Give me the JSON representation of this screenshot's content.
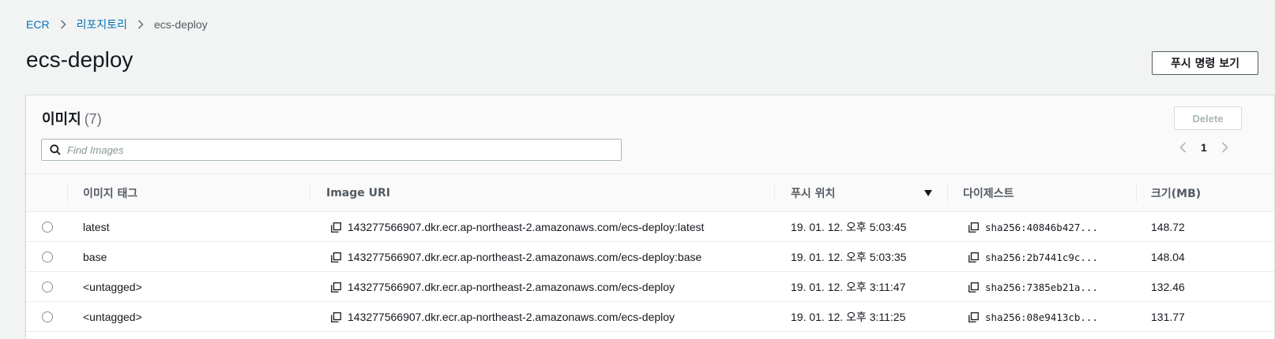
{
  "breadcrumb": {
    "items": [
      {
        "label": "ECR"
      },
      {
        "label": "리포지토리"
      }
    ],
    "current": "ecs-deploy"
  },
  "page": {
    "title": "ecs-deploy",
    "push_button": "푸시 명령 보기"
  },
  "images_panel": {
    "title": "이미지",
    "count": "(7)",
    "delete_label": "Delete",
    "search_placeholder": "Find Images",
    "current_page": "1"
  },
  "table": {
    "columns": {
      "tag": "이미지 태그",
      "uri": "Image URI",
      "pushed_at": "푸시 위치",
      "digest": "다이제스트",
      "size": "크기(MB)"
    },
    "rows": [
      {
        "tag": "latest",
        "uri": "143277566907.dkr.ecr.ap-northeast-2.amazonaws.com/ecs-deploy:latest",
        "pushed_at": "19. 01. 12. 오후 5:03:45",
        "digest": "sha256:40846b427...",
        "size": "148.72"
      },
      {
        "tag": "base",
        "uri": "143277566907.dkr.ecr.ap-northeast-2.amazonaws.com/ecs-deploy:base",
        "pushed_at": "19. 01. 12. 오후 5:03:35",
        "digest": "sha256:2b7441c9c...",
        "size": "148.04"
      },
      {
        "tag": "<untagged>",
        "uri": "143277566907.dkr.ecr.ap-northeast-2.amazonaws.com/ecs-deploy",
        "pushed_at": "19. 01. 12. 오후 3:11:47",
        "digest": "sha256:7385eb21a...",
        "size": "132.46"
      },
      {
        "tag": "<untagged>",
        "uri": "143277566907.dkr.ecr.ap-northeast-2.amazonaws.com/ecs-deploy",
        "pushed_at": "19. 01. 12. 오후 3:11:25",
        "digest": "sha256:08e9413cb...",
        "size": "131.77"
      }
    ]
  }
}
